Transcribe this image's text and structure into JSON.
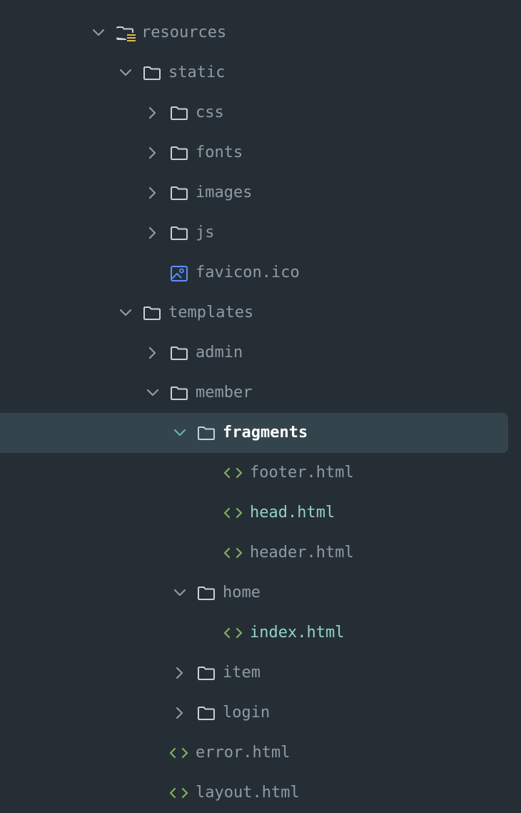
{
  "colors": {
    "background": "#262e35",
    "selection": "#34444d",
    "text": "#8e9ba4",
    "text_selected": "#ffffff",
    "text_modified": "#8fd3c8",
    "chevron": "#8e9ba4",
    "chevron_selected": "#5fb8a6",
    "folder_icon": "#c9d0d6",
    "html_icon": "#7fb35e",
    "image_icon": "#5b8ff9",
    "resource_badge": "#e0b84c"
  },
  "tree": {
    "items": [
      {
        "label": "",
        "depth": 1,
        "state": "none",
        "icon": "partial-icon",
        "style": "normal"
      },
      {
        "label": "resources",
        "depth": 1,
        "state": "expanded",
        "icon": "resources-folder-icon",
        "style": "normal"
      },
      {
        "label": "static",
        "depth": 2,
        "state": "expanded",
        "icon": "folder-icon",
        "style": "normal"
      },
      {
        "label": "css",
        "depth": 3,
        "state": "collapsed",
        "icon": "folder-icon",
        "style": "normal"
      },
      {
        "label": "fonts",
        "depth": 3,
        "state": "collapsed",
        "icon": "folder-icon",
        "style": "normal"
      },
      {
        "label": "images",
        "depth": 3,
        "state": "collapsed",
        "icon": "folder-icon",
        "style": "normal"
      },
      {
        "label": "js",
        "depth": 3,
        "state": "collapsed",
        "icon": "folder-icon",
        "style": "normal"
      },
      {
        "label": "favicon.ico",
        "depth": 3,
        "state": "none",
        "icon": "image-file-icon",
        "style": "normal"
      },
      {
        "label": "templates",
        "depth": 2,
        "state": "expanded",
        "icon": "folder-icon",
        "style": "normal"
      },
      {
        "label": "admin",
        "depth": 3,
        "state": "collapsed",
        "icon": "folder-icon",
        "style": "normal"
      },
      {
        "label": "member",
        "depth": 3,
        "state": "expanded",
        "icon": "folder-icon",
        "style": "normal"
      },
      {
        "label": "fragments",
        "depth": 4,
        "state": "expanded",
        "icon": "folder-icon",
        "style": "selected",
        "selected": true
      },
      {
        "label": "footer.html",
        "depth": 5,
        "state": "none",
        "icon": "html-file-icon",
        "style": "normal"
      },
      {
        "label": "head.html",
        "depth": 5,
        "state": "none",
        "icon": "html-file-icon",
        "style": "modified"
      },
      {
        "label": "header.html",
        "depth": 5,
        "state": "none",
        "icon": "html-file-icon",
        "style": "normal"
      },
      {
        "label": "home",
        "depth": 4,
        "state": "expanded",
        "icon": "folder-icon",
        "style": "normal"
      },
      {
        "label": "index.html",
        "depth": 5,
        "state": "none",
        "icon": "html-file-icon",
        "style": "modified"
      },
      {
        "label": "item",
        "depth": 4,
        "state": "collapsed",
        "icon": "folder-icon",
        "style": "normal"
      },
      {
        "label": "login",
        "depth": 4,
        "state": "collapsed",
        "icon": "folder-icon",
        "style": "normal"
      },
      {
        "label": "error.html",
        "depth": 3,
        "state": "none",
        "icon": "html-file-icon",
        "style": "normal"
      },
      {
        "label": "layout.html",
        "depth": 3,
        "state": "none",
        "icon": "html-file-icon",
        "style": "normal"
      }
    ]
  }
}
